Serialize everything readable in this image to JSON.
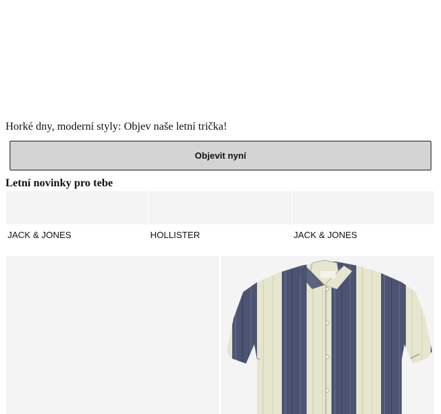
{
  "promo": {
    "headline": "Horké dny, moderní styly: Objev naše letní trička!",
    "cta_label": "Objevit nyní"
  },
  "section": {
    "title": "Letní novinky pro tebe"
  },
  "brands": [
    {
      "name": "JACK & JONES"
    },
    {
      "name": "HOLLISTER"
    },
    {
      "name": "JACK & JONES"
    }
  ],
  "products": [
    {
      "image": "product-image-placeholder"
    },
    {
      "image": "striped-short-sleeve-shirt"
    }
  ],
  "colors": {
    "button_bg": "#d4d4d4",
    "tile_bg": "#f4f4f4",
    "stripe_navy": "#4d5473",
    "stripe_cream": "#e6e6cf"
  }
}
